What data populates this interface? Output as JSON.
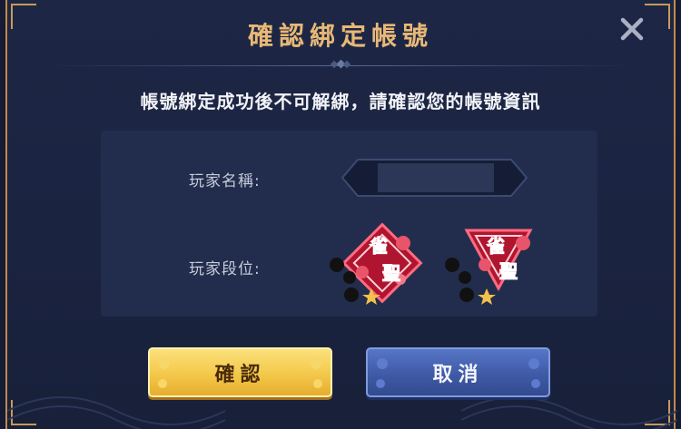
{
  "dialog": {
    "title": "確認綁定帳號",
    "notice": "帳號綁定成功後不可解綁，請確認您的帳號資訊"
  },
  "player": {
    "name_label": "玩家名稱:",
    "name_value": "",
    "rank_label": "玩家段位:",
    "rank_badges": [
      {
        "rank": "雀聖",
        "stars": 1,
        "icon": "rank-badge-icon"
      },
      {
        "rank": "雀聖",
        "stars": 1,
        "icon": "rank-badge-icon"
      }
    ]
  },
  "buttons": {
    "confirm_label": "確認",
    "cancel_label": "取消"
  },
  "icons": {
    "close": "close-icon"
  },
  "colors": {
    "title_gold": "#e8b876",
    "confirm_yellow": "#f3c84a",
    "cancel_blue": "#3f5aa6",
    "badge_red": "#c8203a"
  }
}
